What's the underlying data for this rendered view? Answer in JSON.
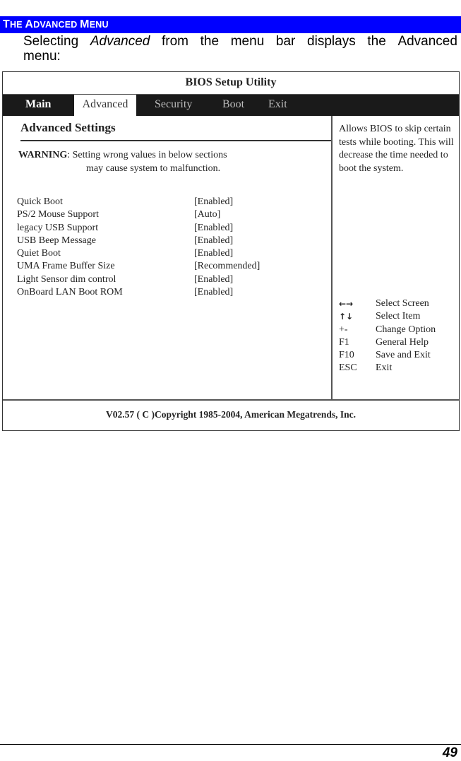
{
  "section": {
    "title_parts": [
      {
        "text": "T",
        "size": "big"
      },
      {
        "text": "HE ",
        "size": "sm"
      },
      {
        "text": "A",
        "size": "big"
      },
      {
        "text": "DVANCED ",
        "size": "sm"
      },
      {
        "text": "M",
        "size": "big"
      },
      {
        "text": "ENU",
        "size": "sm"
      }
    ],
    "intro_line1": [
      "Selecting",
      "Advanced",
      "from",
      "the",
      "menu",
      "bar",
      "displays",
      "the",
      "Advanced"
    ],
    "intro_line2": "menu:",
    "accent_color": "#0000ff"
  },
  "bios": {
    "title": "BIOS Setup Utility",
    "tabs": [
      {
        "label": "Main",
        "active": false
      },
      {
        "label": "Advanced",
        "active": true
      },
      {
        "label": "Security",
        "active": false
      },
      {
        "label": "Boot",
        "active": false
      },
      {
        "label": "Exit",
        "active": false
      }
    ],
    "heading": "Advanced Settings",
    "warning_label": "WARNING",
    "warning_line1": ": Setting wrong values in below sections",
    "warning_line2": "may cause system to malfunction.",
    "settings": [
      {
        "label": "Quick Boot",
        "value": "[Enabled]"
      },
      {
        "label": "PS/2 Mouse Support",
        "value": "[Auto]"
      },
      {
        "label": "legacy USB Support",
        "value": "[Enabled]"
      },
      {
        "label": "USB Beep Message",
        "value": "[Enabled]"
      },
      {
        "label": "Quiet Boot",
        "value": "[Enabled]"
      },
      {
        "label": "UMA Frame Buffer Size",
        "value": "[Recommended]"
      },
      {
        "label": "Light Sensor dim control",
        "value": "[Enabled]"
      },
      {
        "label": "OnBoard LAN Boot ROM",
        "value": "[Enabled]"
      }
    ],
    "help_text": "Allows BIOS to skip certain tests while booting. This will decrease the time needed to boot the system.",
    "keys": [
      {
        "key": "←→",
        "icon": "left-right-arrows-icon",
        "desc": "Select Screen"
      },
      {
        "key": "↑↓",
        "icon": "up-down-arrows-icon",
        "desc": "Select Item"
      },
      {
        "key": "+-",
        "icon": "plus-minus-icon",
        "desc": "Change Option"
      },
      {
        "key": "F1",
        "icon": "",
        "desc": "General Help"
      },
      {
        "key": "F10",
        "icon": "",
        "desc": "Save and Exit"
      },
      {
        "key": "ESC",
        "icon": "",
        "desc": "Exit"
      }
    ],
    "footer": "V02.57 ( C )Copyright 1985-2004, American Megatrends, Inc."
  },
  "page": {
    "number": "49"
  }
}
